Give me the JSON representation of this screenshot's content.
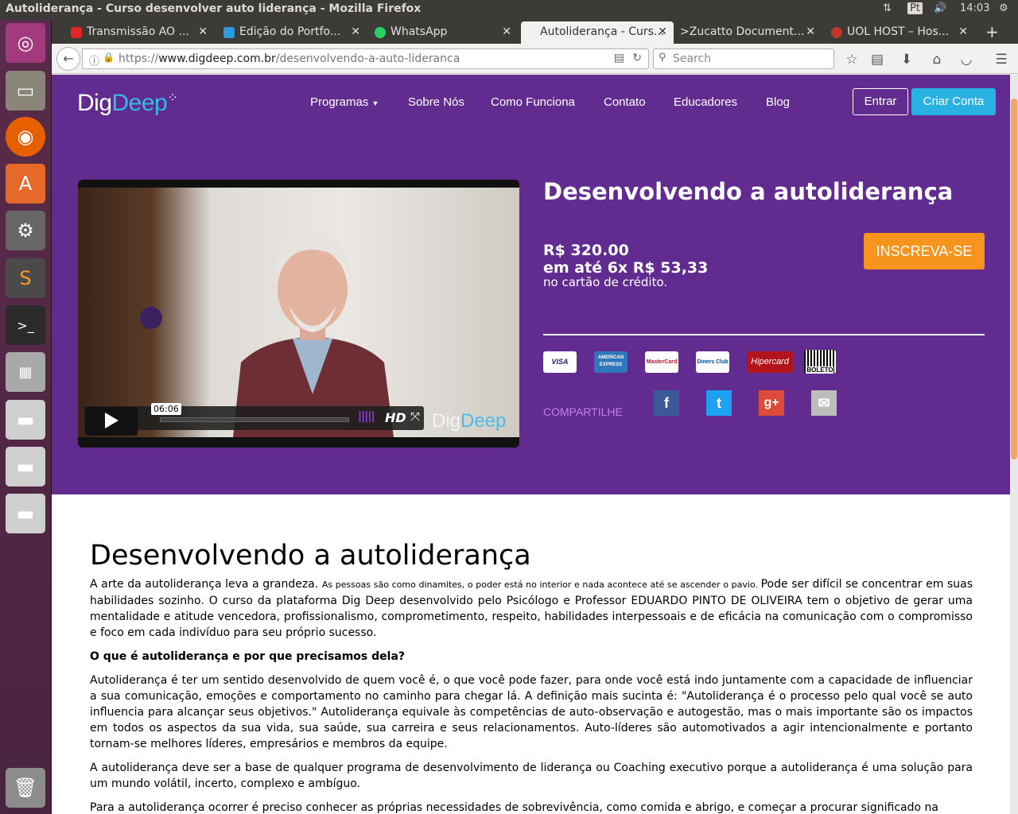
{
  "system": {
    "window_title": "Autoliderança - Curso desenvolver auto liderança - Mozilla Firefox",
    "keyboard": "Pt",
    "clock": "14:03"
  },
  "tabs": [
    {
      "label": "Transmissão AO ...",
      "favicon_color": "#e02525"
    },
    {
      "label": "Edição do Portfo...",
      "favicon_color": "#2d9cdb"
    },
    {
      "label": "WhatsApp",
      "favicon_color": "#25d366"
    },
    {
      "label": "Autoliderança - Curs...",
      "favicon_color": "#ffffff"
    },
    {
      "label": ">Zucatto Document...",
      "favicon_color": "#3c3b37"
    },
    {
      "label": "UOL HOST – Hos...",
      "favicon_color": "#c0392b"
    }
  ],
  "url": {
    "scheme": "https://",
    "host": "www.digdeep.com.br",
    "path": "/desenvolvendo-a-auto-lideranca"
  },
  "search_placeholder": "Search",
  "site": {
    "logo_dig": "Dig",
    "logo_deep": "Deep",
    "menu": [
      "Programas",
      "Sobre Nós",
      "Como Funciona",
      "Contato",
      "Educadores",
      "Blog"
    ],
    "login": "Entrar",
    "signup": "Criar Conta",
    "brand_color": "#612b8f",
    "accent_color": "#29b1e3",
    "cta_color": "#f7941e"
  },
  "hero": {
    "title": "Desenvolvendo a autoliderança",
    "price": "R$ 320.00",
    "installments": "em até 6x R$ 53,33",
    "card_note": "no cartão de crédito.",
    "enroll": "INSCREVA-SE",
    "payments": [
      "VISA",
      "AMERICAN EXPRESS",
      "MasterCard",
      "Diners Club",
      "Hipercard",
      "BOLETO"
    ],
    "share_label": "COMPARTILHE",
    "share": [
      {
        "icon": "facebook-icon",
        "glyph": "f",
        "color": "#3b5998"
      },
      {
        "icon": "twitter-icon",
        "glyph": "t",
        "color": "#1da1f2"
      },
      {
        "icon": "google-plus-icon",
        "glyph": "g+",
        "color": "#dd4b39"
      },
      {
        "icon": "email-icon",
        "glyph": "✉",
        "color": "#bdbdbd"
      }
    ]
  },
  "video": {
    "time": "06:06",
    "hd": "HD",
    "watermark_dig": "Dig",
    "watermark_deep": "Deep"
  },
  "article": {
    "heading": "Desenvolvendo a autoliderança",
    "p1a": "A arte da autoliderança leva a grandeza. ",
    "p1b": "As pessoas são como dinamites, o poder está no interior e nada acontece até se ascender o pavio. ",
    "p1c": "Pode ser difícil se concentrar em suas habilidades sozinho. O curso da plataforma Dig Deep desenvolvido pelo Psicólogo e Professor EDUARDO PINTO DE OLIVEIRA tem o objetivo de gerar uma mentalidade e atitude vencedora, profissionalismo, comprometimento, respeito, habilidades interpessoais e de eficácia na comunicação com o compromisso e foco em cada indivíduo para seu próprio sucesso.",
    "subheading": "O que é autoliderança e por que precisamos dela?",
    "p2": "Autoliderança é ter um sentido desenvolvido de quem você é, o que você pode fazer, para onde você está indo juntamente com a capacidade de influenciar a sua comunicação, emoções e comportamento no caminho para chegar lá. A definição mais sucinta é: \"Autoliderança é o processo pelo qual você se auto influencia para alcançar seus objetivos.\" Autoliderança equivale às competências de auto-observação e autogestão, mas o mais importante são os impactos em todos os aspectos da sua vida, sua saúde, sua carreira e seus relacionamentos. Auto-líderes são automotivados a agir intencionalmente e portanto tornam-se melhores líderes, empresários e membros da equipe.",
    "p3": "A autoliderança deve ser a base de qualquer programa de desenvolvimento de liderança ou Coaching executivo porque a autoliderança é uma solução para um mundo volátil, incerto, complexo e ambíguo.",
    "p4": "Para a autoliderança ocorrer é preciso conhecer as próprias necessidades de sobrevivência, como comida e abrigo, e começar a procurar significado na"
  }
}
